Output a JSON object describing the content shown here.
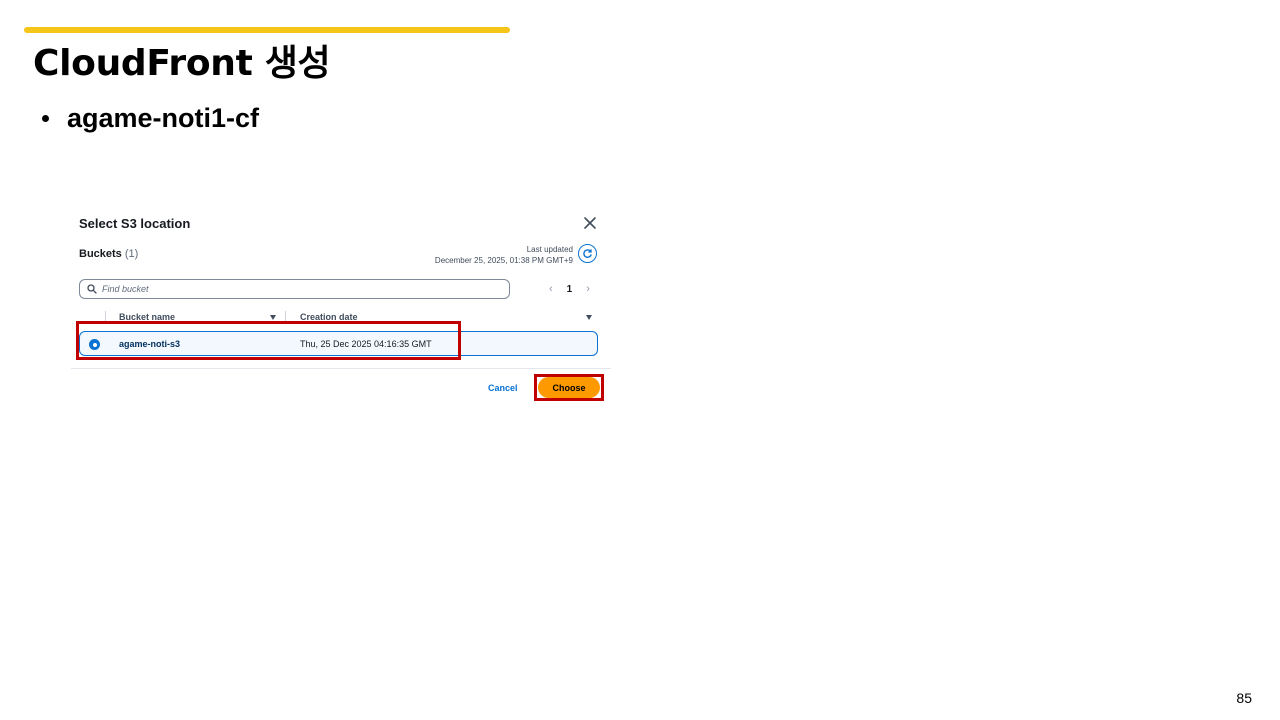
{
  "slide": {
    "title": "CloudFront 생성",
    "bullet": "agame-noti1-cf",
    "page_number": "85"
  },
  "colors": {
    "accent_bar": "#f5c518",
    "highlight": "#c00000",
    "primary_button": "#ff9900",
    "link": "#0972d3"
  },
  "modal": {
    "title": "Select S3 location",
    "buckets_label": "Buckets",
    "buckets_count": "(1)",
    "last_updated_label": "Last updated",
    "last_updated_value": "December 25, 2025, 01:38 PM GMT+9",
    "search_placeholder": "Find bucket",
    "pagination": {
      "prev": "‹",
      "current": "1",
      "next": "›"
    },
    "columns": [
      "Bucket name",
      "Creation date"
    ],
    "rows": [
      {
        "selected": true,
        "bucket_name": "agame-noti-s3",
        "creation_date": "Thu, 25 Dec 2025 04:16:35 GMT"
      }
    ],
    "cancel_label": "Cancel",
    "choose_label": "Choose",
    "icons": {
      "close": "close-icon",
      "refresh": "refresh-icon",
      "search": "search-icon"
    }
  }
}
